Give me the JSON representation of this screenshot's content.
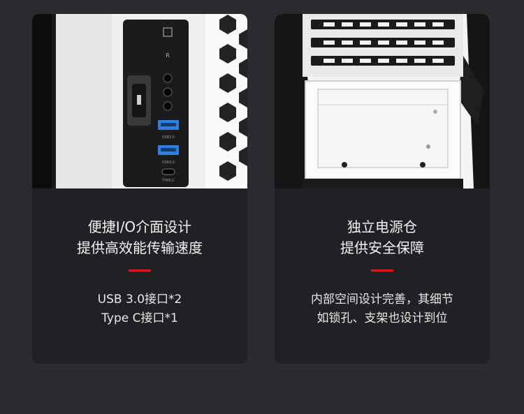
{
  "cards": [
    {
      "image_subject": "front-io-panel-photo",
      "title_lines": [
        "便捷I/O介面设计",
        "提供高效能传输速度"
      ],
      "desc_lines": [
        "USB 3.0接口*2",
        "Type C接口*1"
      ],
      "photo_labels": {
        "reset": "R",
        "usb_1": "USB3.0",
        "usb_2": "USB3.0",
        "typec": "TYPE-C"
      }
    },
    {
      "image_subject": "psu-compartment-photo",
      "title_lines": [
        "独立电源仓",
        "提供安全保障"
      ],
      "desc_lines": [
        "内部空间设计完善，其细节",
        "如锁孔、支架也设计到位"
      ]
    }
  ],
  "colors": {
    "background": "#2a2b2f",
    "card": "#202124",
    "accent": "#d7191e",
    "text": "#f2f2f2"
  }
}
